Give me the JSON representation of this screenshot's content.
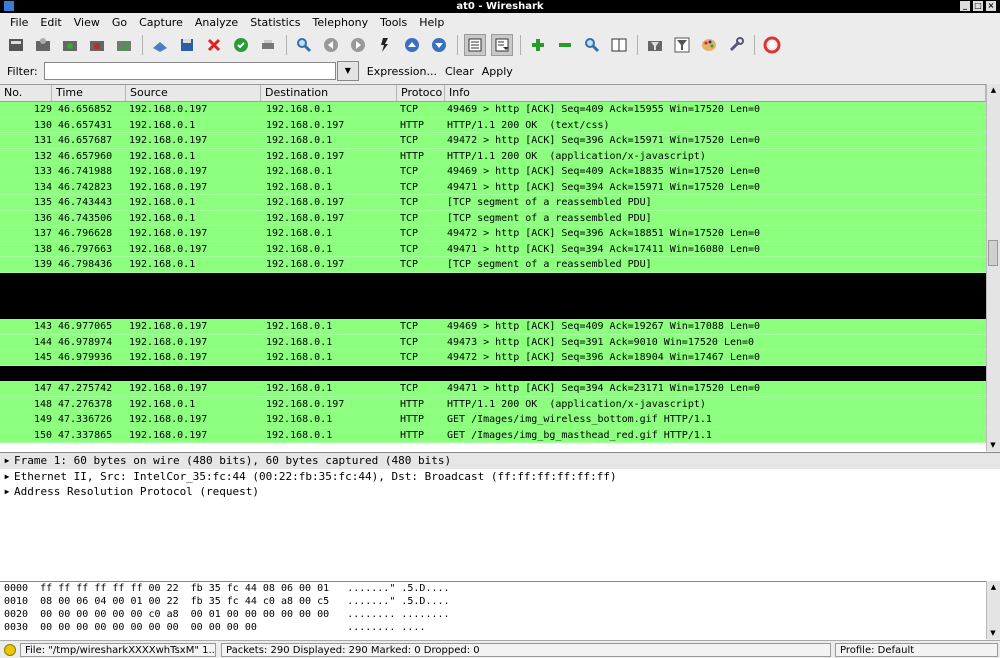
{
  "window": {
    "title": "at0 - Wireshark"
  },
  "menu": [
    "File",
    "Edit",
    "View",
    "Go",
    "Capture",
    "Analyze",
    "Statistics",
    "Telephony",
    "Tools",
    "Help"
  ],
  "toolbar": {
    "icons": [
      "interface-list-icon",
      "capture-options-icon",
      "start-capture-icon",
      "stop-capture-icon",
      "restart-capture-icon",
      "open-file-icon",
      "save-file-icon",
      "close-file-icon",
      "reload-icon",
      "print-icon",
      "find-packet-icon",
      "go-back-icon",
      "go-forward-icon",
      "go-to-packet-icon",
      "go-first-icon",
      "go-last-icon",
      "colorize-icon",
      "auto-scroll-icon",
      "zoom-in-icon",
      "zoom-out-icon",
      "normal-size-icon",
      "resize-columns-icon",
      "capture-filters-icon",
      "display-filters-icon",
      "coloring-rules-icon",
      "preferences-icon",
      "help-icon"
    ]
  },
  "filter": {
    "label": "Filter:",
    "value": "",
    "expression": "Expression...",
    "clear": "Clear",
    "apply": "Apply"
  },
  "columns": [
    "No.",
    "Time",
    "Source",
    "Destination",
    "Protoco",
    "Info"
  ],
  "packets": [
    {
      "no": "129",
      "time": "46.656852",
      "src": "192.168.0.197",
      "dst": "192.168.0.1",
      "proto": "TCP",
      "info": "49469 > http [ACK] Seq=409 Ack=15955 Win=17520 Len=0",
      "color": "green"
    },
    {
      "no": "130",
      "time": "46.657431",
      "src": "192.168.0.1",
      "dst": "192.168.0.197",
      "proto": "HTTP",
      "info": "HTTP/1.1 200 OK  (text/css)",
      "color": "green"
    },
    {
      "no": "131",
      "time": "46.657687",
      "src": "192.168.0.197",
      "dst": "192.168.0.1",
      "proto": "TCP",
      "info": "49472 > http [ACK] Seq=396 Ack=15971 Win=17520 Len=0",
      "color": "green"
    },
    {
      "no": "132",
      "time": "46.657960",
      "src": "192.168.0.1",
      "dst": "192.168.0.197",
      "proto": "HTTP",
      "info": "HTTP/1.1 200 OK  (application/x-javascript)",
      "color": "green"
    },
    {
      "no": "133",
      "time": "46.741988",
      "src": "192.168.0.197",
      "dst": "192.168.0.1",
      "proto": "TCP",
      "info": "49469 > http [ACK] Seq=409 Ack=18835 Win=17520 Len=0",
      "color": "green"
    },
    {
      "no": "134",
      "time": "46.742823",
      "src": "192.168.0.197",
      "dst": "192.168.0.1",
      "proto": "TCP",
      "info": "49471 > http [ACK] Seq=394 Ack=15971 Win=17520 Len=0",
      "color": "green"
    },
    {
      "no": "135",
      "time": "46.743443",
      "src": "192.168.0.1",
      "dst": "192.168.0.197",
      "proto": "TCP",
      "info": "[TCP segment of a reassembled PDU]",
      "color": "green"
    },
    {
      "no": "136",
      "time": "46.743506",
      "src": "192.168.0.1",
      "dst": "192.168.0.197",
      "proto": "TCP",
      "info": "[TCP segment of a reassembled PDU]",
      "color": "green"
    },
    {
      "no": "137",
      "time": "46.796628",
      "src": "192.168.0.197",
      "dst": "192.168.0.1",
      "proto": "TCP",
      "info": "49472 > http [ACK] Seq=396 Ack=18851 Win=17520 Len=0",
      "color": "green"
    },
    {
      "no": "138",
      "time": "46.797663",
      "src": "192.168.0.197",
      "dst": "192.168.0.1",
      "proto": "TCP",
      "info": "49471 > http [ACK] Seq=394 Ack=17411 Win=16080 Len=0",
      "color": "green"
    },
    {
      "no": "139",
      "time": "46.798436",
      "src": "192.168.0.1",
      "dst": "192.168.0.197",
      "proto": "TCP",
      "info": "[TCP segment of a reassembled PDU]",
      "color": "green"
    },
    {
      "no": "",
      "time": "",
      "src": "",
      "dst": "",
      "proto": "",
      "info": "",
      "color": "black"
    },
    {
      "no": "",
      "time": "",
      "src": "",
      "dst": "",
      "proto": "",
      "info": "",
      "color": "black"
    },
    {
      "no": "",
      "time": "",
      "src": "",
      "dst": "",
      "proto": "",
      "info": "",
      "color": "black"
    },
    {
      "no": "143",
      "time": "46.977065",
      "src": "192.168.0.197",
      "dst": "192.168.0.1",
      "proto": "TCP",
      "info": "49469 > http [ACK] Seq=409 Ack=19267 Win=17088 Len=0",
      "color": "green"
    },
    {
      "no": "144",
      "time": "46.978974",
      "src": "192.168.0.197",
      "dst": "192.168.0.1",
      "proto": "TCP",
      "info": "49473 > http [ACK] Seq=391 Ack=9010 Win=17520 Len=0",
      "color": "green"
    },
    {
      "no": "145",
      "time": "46.979936",
      "src": "192.168.0.197",
      "dst": "192.168.0.1",
      "proto": "TCP",
      "info": "49472 > http [ACK] Seq=396 Ack=18904 Win=17467 Len=0",
      "color": "green"
    },
    {
      "no": "",
      "time": "",
      "src": "",
      "dst": "",
      "proto": "",
      "info": "",
      "color": "black"
    },
    {
      "no": "147",
      "time": "47.275742",
      "src": "192.168.0.197",
      "dst": "192.168.0.1",
      "proto": "TCP",
      "info": "49471 > http [ACK] Seq=394 Ack=23171 Win=17520 Len=0",
      "color": "green"
    },
    {
      "no": "148",
      "time": "47.276378",
      "src": "192.168.0.1",
      "dst": "192.168.0.197",
      "proto": "HTTP",
      "info": "HTTP/1.1 200 OK  (application/x-javascript)",
      "color": "green"
    },
    {
      "no": "149",
      "time": "47.336726",
      "src": "192.168.0.197",
      "dst": "192.168.0.1",
      "proto": "HTTP",
      "info": "GET /Images/img_wireless_bottom.gif HTTP/1.1",
      "color": "green"
    },
    {
      "no": "150",
      "time": "47.337865",
      "src": "192.168.0.197",
      "dst": "192.168.0.1",
      "proto": "HTTP",
      "info": "GET /Images/img_bg_masthead_red.gif HTTP/1.1",
      "color": "green"
    }
  ],
  "details": [
    "Frame 1: 60 bytes on wire (480 bits), 60 bytes captured (480 bits)",
    "Ethernet II, Src: IntelCor_35:fc:44 (00:22:fb:35:fc:44), Dst: Broadcast (ff:ff:ff:ff:ff:ff)",
    "Address Resolution Protocol (request)"
  ],
  "bytes": [
    {
      "offset": "0000",
      "hex": "ff ff ff ff ff ff 00 22  fb 35 fc 44 08 06 00 01",
      "ascii": ".......\" .5.D...."
    },
    {
      "offset": "0010",
      "hex": "08 00 06 04 00 01 00 22  fb 35 fc 44 c0 a8 00 c5",
      "ascii": ".......\" .5.D...."
    },
    {
      "offset": "0020",
      "hex": "00 00 00 00 00 00 c0 a8  00 01 00 00 00 00 00 00",
      "ascii": "........ ........"
    },
    {
      "offset": "0030",
      "hex": "00 00 00 00 00 00 00 00  00 00 00 00",
      "ascii": "........ ...."
    }
  ],
  "status": {
    "file": "File: \"/tmp/wiresharkXXXXwhTsxM\" 1...",
    "packets": "Packets: 290 Displayed: 290 Marked: 0 Dropped: 0",
    "profile": "Profile: Default"
  }
}
